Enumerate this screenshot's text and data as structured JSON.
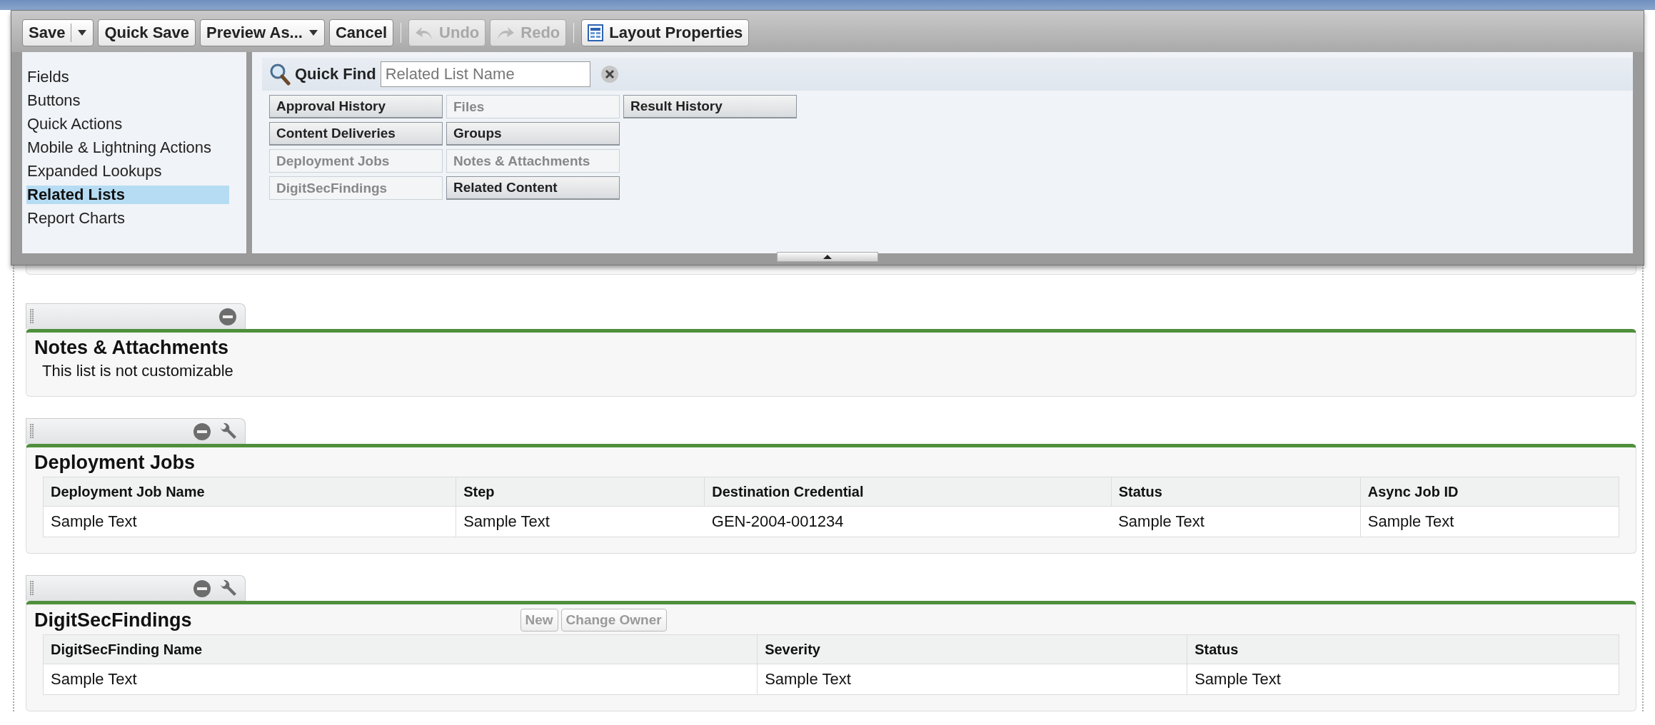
{
  "toolbar": {
    "buttons": [
      {
        "label": "Save",
        "kind": "split",
        "disabled": false
      },
      {
        "label": "Quick Save",
        "kind": "plain",
        "disabled": false
      },
      {
        "label": "Preview As...",
        "kind": "dropdown",
        "disabled": false
      },
      {
        "label": "Cancel",
        "kind": "plain",
        "disabled": false
      },
      {
        "label": "Undo",
        "kind": "undo",
        "disabled": true
      },
      {
        "label": "Redo",
        "kind": "redo",
        "disabled": true
      },
      {
        "label": "Layout Properties",
        "kind": "properties",
        "disabled": false
      }
    ]
  },
  "palette": {
    "categories": [
      {
        "label": "Fields",
        "selected": false
      },
      {
        "label": "Buttons",
        "selected": false
      },
      {
        "label": "Quick Actions",
        "selected": false
      },
      {
        "label": "Mobile & Lightning Actions",
        "selected": false
      },
      {
        "label": "Expanded Lookups",
        "selected": false
      },
      {
        "label": "Related Lists",
        "selected": true
      },
      {
        "label": "Report Charts",
        "selected": false
      }
    ],
    "quick_find": {
      "label": "Quick Find",
      "placeholder": "Related List Name"
    },
    "items": [
      {
        "label": "Approval History",
        "in_use": false
      },
      {
        "label": "Content Deliveries",
        "in_use": false
      },
      {
        "label": "Deployment Jobs",
        "in_use": true
      },
      {
        "label": "DigitSecFindings",
        "in_use": true
      },
      {
        "label": "Files",
        "in_use": true
      },
      {
        "label": "Groups",
        "in_use": false
      },
      {
        "label": "Notes & Attachments",
        "in_use": true
      },
      {
        "label": "Related Content",
        "in_use": false
      },
      {
        "label": "Result History",
        "in_use": false
      }
    ]
  },
  "related_lists": [
    {
      "title": "Notes & Attachments",
      "removable": true,
      "editable": false,
      "message": "This list is not customizable"
    },
    {
      "title": "Deployment Jobs",
      "removable": true,
      "editable": true,
      "columns": [
        "Deployment Job Name",
        "Step",
        "Destination Credential",
        "Status",
        "Async Job ID"
      ],
      "rows": [
        [
          "Sample Text",
          "Sample Text",
          "GEN-2004-001234",
          "Sample Text",
          "Sample Text"
        ]
      ]
    },
    {
      "title": "DigitSecFindings",
      "removable": true,
      "editable": true,
      "buttons": [
        "New",
        "Change Owner"
      ],
      "columns": [
        "DigitSecFinding Name",
        "Severity",
        "Status"
      ],
      "rows": [
        [
          "Sample Text",
          "Sample Text",
          "Sample Text"
        ]
      ]
    }
  ]
}
